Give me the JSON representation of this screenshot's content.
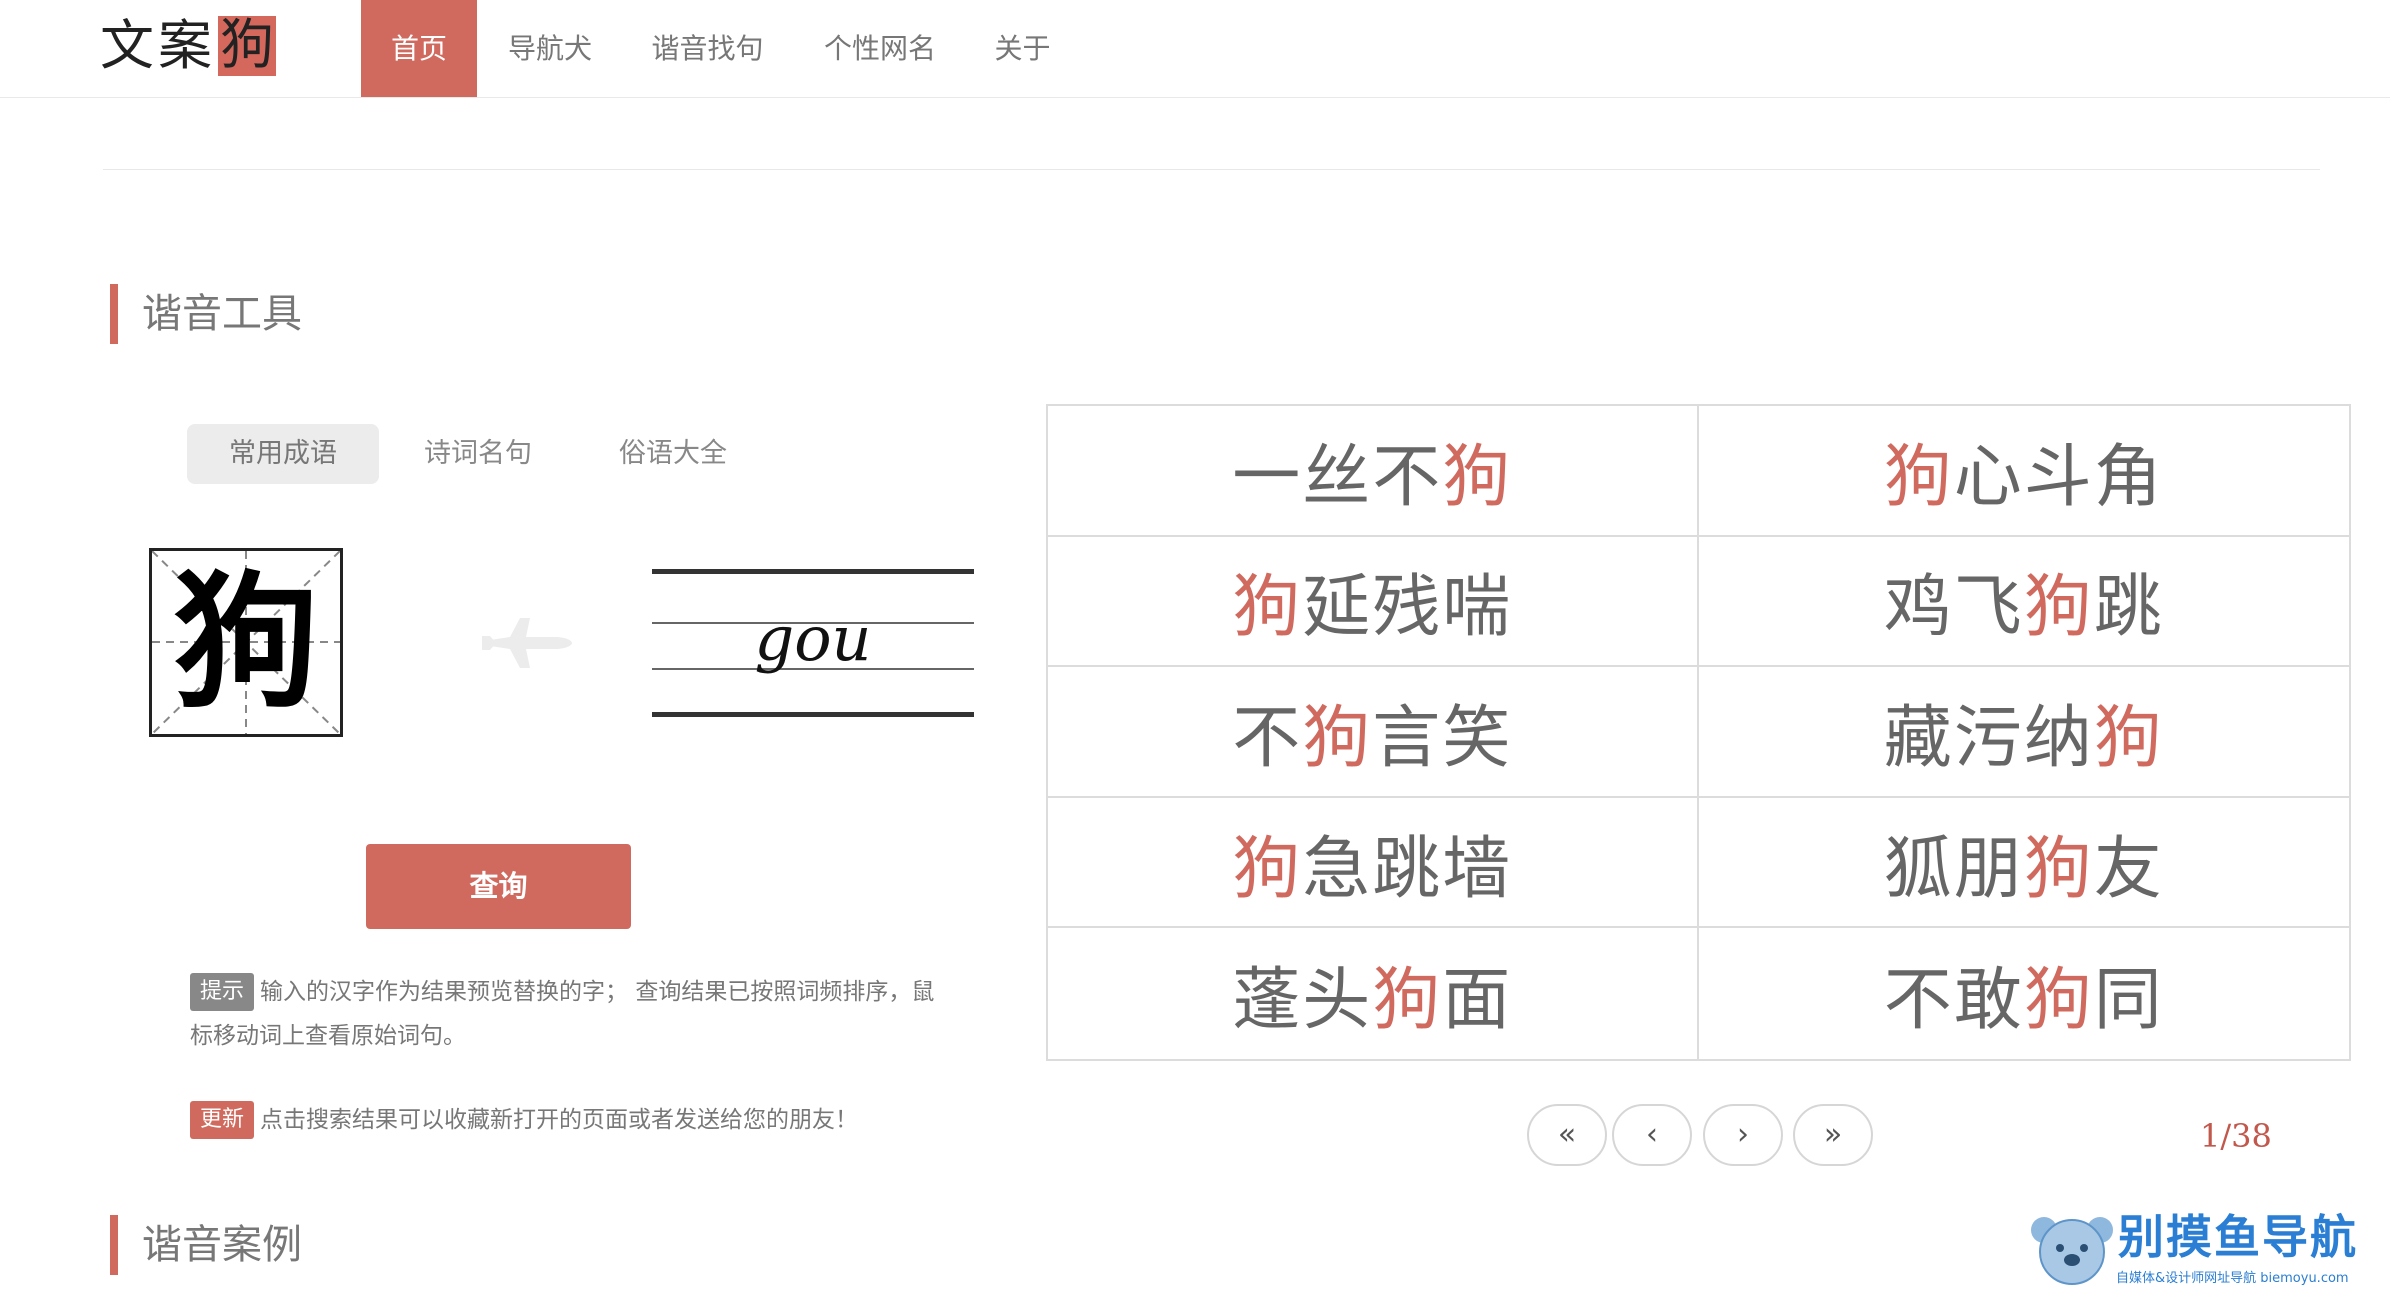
{
  "logo": {
    "text": "文案",
    "badge": "狗"
  },
  "nav": [
    {
      "label": "首页",
      "active": true
    },
    {
      "label": "导航犬"
    },
    {
      "label": "谐音找句"
    },
    {
      "label": "个性网名"
    },
    {
      "label": "关于"
    }
  ],
  "section1_title": "谐音工具",
  "section2_title": "谐音案例",
  "tabs": [
    {
      "label": "常用成语",
      "selected": true
    },
    {
      "label": "诗词名句"
    },
    {
      "label": "俗语大全"
    }
  ],
  "input_char": "狗",
  "pinyin": "gou",
  "query_button": "查询",
  "tips": {
    "hint_badge": "提示",
    "hint_line1": "输入的汉字作为结果预览替换的字； 查询结果已按照词频排序，鼠",
    "hint_line2": "标移动词上查看原始词句。",
    "update_badge": "更新",
    "update_text": "点击搜索结果可以收藏新打开的页面或者发送给您的朋友！"
  },
  "results": [
    {
      "pre": "一丝不",
      "hl": "狗",
      "post": ""
    },
    {
      "pre": "",
      "hl": "狗",
      "post": "心斗角"
    },
    {
      "pre": "",
      "hl": "狗",
      "post": "延残喘"
    },
    {
      "pre": "鸡飞",
      "hl": "狗",
      "post": "跳"
    },
    {
      "pre": "不",
      "hl": "狗",
      "post": "言笑"
    },
    {
      "pre": "藏污纳",
      "hl": "狗",
      "post": ""
    },
    {
      "pre": "",
      "hl": "狗",
      "post": "急跳墙"
    },
    {
      "pre": "狐朋",
      "hl": "狗",
      "post": "友"
    },
    {
      "pre": "蓬头",
      "hl": "狗",
      "post": "面"
    },
    {
      "pre": "不敢",
      "hl": "狗",
      "post": "同"
    }
  ],
  "pagination": {
    "first": "«",
    "prev": "‹",
    "next": "›",
    "last": "»",
    "current": 1,
    "total": 38,
    "label": "1/38"
  },
  "watermark": {
    "main": "别摸鱼导航",
    "sub": "自媒体&设计师网址导航 biemoyu.com"
  },
  "colors": {
    "accent": "#d06a5e",
    "text": "#666666"
  },
  "icons": [
    "airplane-icon",
    "koala-mascot-icon"
  ]
}
